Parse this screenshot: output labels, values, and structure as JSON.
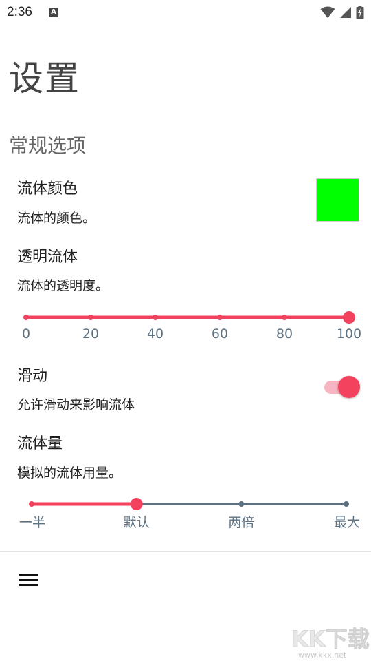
{
  "status_bar": {
    "time": "2:36",
    "notification_icon": "a-letter-icon",
    "icons": [
      "wifi-icon",
      "signal-icon",
      "battery-charging-icon"
    ]
  },
  "page_title": "设置",
  "section": {
    "title": "常规选项"
  },
  "preferences": {
    "fluid_color": {
      "title": "流体颜色",
      "summary": "流体的颜色。",
      "color": "#00ff00"
    },
    "transparent_fluid": {
      "title": "透明流体",
      "summary": "流体的透明度。",
      "slider": {
        "value": 100,
        "min": 0,
        "max": 100,
        "ticks": [
          "0",
          "20",
          "40",
          "60",
          "80",
          "100"
        ]
      }
    },
    "swipe": {
      "title": "滑动",
      "summary": "允许滑动来影响流体",
      "enabled": true
    },
    "fluid_amount": {
      "title": "流体量",
      "summary": "模拟的流体用量。",
      "slider": {
        "selected_index": 1,
        "options": [
          "一半",
          "默认",
          "两倍",
          "最大"
        ]
      }
    }
  },
  "bottom_bar": {
    "menu_icon": "hamburger-menu-icon"
  },
  "watermark": {
    "text": "KK下载",
    "url": "www.kkx.net"
  },
  "colors": {
    "accent": "#f2425e",
    "inactive_track": "#5e7282",
    "tick_label": "#5e7282"
  }
}
